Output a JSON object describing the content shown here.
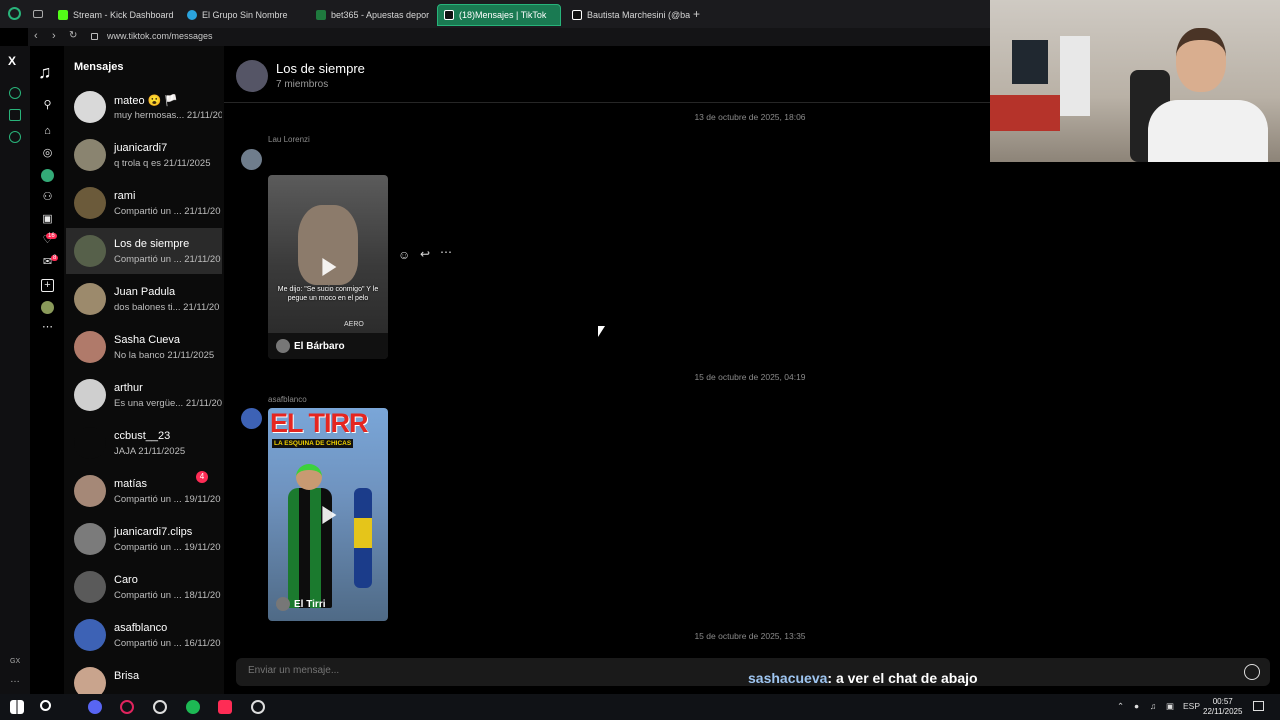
{
  "browser": {
    "tabs": [
      {
        "label": "Stream - Kick Dashboard",
        "icon": "kick-icon",
        "color": "#53fc18"
      },
      {
        "label": "El Grupo Sin Nombre",
        "icon": "telegram-icon",
        "color": "#2aa3dd"
      },
      {
        "label": "bet365 - Apuestas depor",
        "icon": "bet365-icon",
        "color": "#1f7a3e"
      },
      {
        "label": "(18)Mensajes | TikTok",
        "icon": "tiktok-icon",
        "color": "#ffffff",
        "active": true
      },
      {
        "label": "Bautista Marchesini (@ba",
        "icon": "tiktok-icon",
        "color": "#ffffff"
      }
    ],
    "url": "www.tiktok.com/messages"
  },
  "opera_sidebar": {
    "bottom_label": "GX",
    "more": "…"
  },
  "tiktok_rail": {
    "notifications_badge": "16",
    "messages_badge": "8"
  },
  "conversations": {
    "title": "Mensajes",
    "items": [
      {
        "name": "mateo 😮 🏳️‍",
        "preview": "muy hermosas... 21/11/20",
        "avatar_color": "#d9d9d9"
      },
      {
        "name": "juanicardi7",
        "preview": "q trola q es 21/11/2025",
        "avatar_color": "#8a8470"
      },
      {
        "name": "rami",
        "preview": "Compartió un ... 21/11/20",
        "avatar_color": "#6b5a3a"
      },
      {
        "name": "Los de siempre",
        "preview": "Compartió un ... 21/11/20",
        "avatar_color": "#56604a",
        "active": true
      },
      {
        "name": "Juan Padula",
        "preview": "dos balones ti... 21/11/20",
        "avatar_color": "#9c8a6c"
      },
      {
        "name": "Sasha Cueva",
        "preview": "No la banco 21/11/2025",
        "avatar_color": "#b07a6a"
      },
      {
        "name": "arthur",
        "preview": "Es una vergüe... 21/11/20",
        "avatar_color": "#cfcfcf"
      },
      {
        "name": "ccbust__23",
        "preview": "JAJA 21/11/2025",
        "avatar_color": "#0b0b0b"
      },
      {
        "name": "matías",
        "preview": "Compartió un ... 19/11/20",
        "avatar_color": "#a58877",
        "badge": "4"
      },
      {
        "name": "juanicardi7.clips",
        "preview": "Compartió un ... 19/11/20",
        "avatar_color": "#7b7b7b"
      },
      {
        "name": "Caro",
        "preview": "Compartió un ... 18/11/20",
        "avatar_color": "#5a5a5a"
      },
      {
        "name": "asafblanco",
        "preview": "Compartió un ... 16/11/20",
        "avatar_color": "#3d62b5"
      },
      {
        "name": "Brisa",
        "preview": "",
        "avatar_color": "#c9a48d"
      }
    ]
  },
  "chat": {
    "name": "Los de siempre",
    "members": "7 miembros",
    "messages": [
      {
        "date": "13 de octubre de 2025, 18:06",
        "sender": "Lau Lorenzi",
        "avatar_color": "#6f7d8c",
        "video_caption": "Me dijo: \"Se sucio conmigo\" Y le pegue un moco en el pelo",
        "video_author": "El Bárbaro",
        "video_badge": "AERO"
      },
      {
        "date": "15 de octubre de 2025, 04:19",
        "sender": "asafblanco",
        "avatar_color": "#3d62b5",
        "video_title": "EL TIRR",
        "video_subtitle": "LA ESQUINA DE CHICAS",
        "video_author": "El Tirri"
      }
    ],
    "last_date": "15 de octubre de 2025, 13:35",
    "composer_placeholder": "Enviar un mensaje..."
  },
  "overlay": {
    "user": "sashacueva",
    "text": ": a ver el chat de abajo"
  },
  "taskbar": {
    "lang": "ESP",
    "time": "00:57",
    "date": "22/11/2025"
  }
}
